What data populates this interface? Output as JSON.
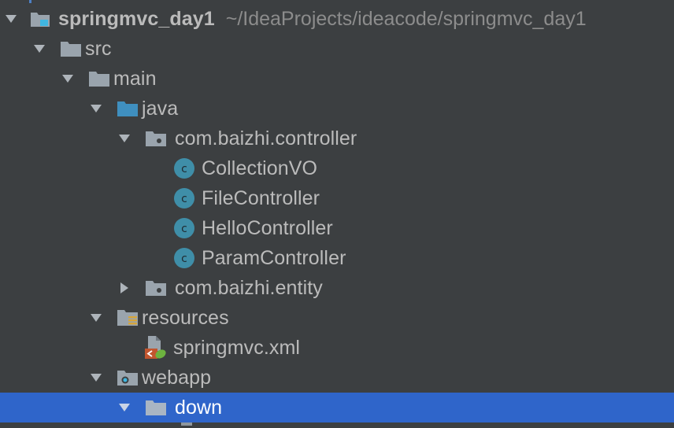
{
  "project_tree": {
    "root": {
      "name": "springmvc_day1",
      "path": "~/IdeaProjects/ideacode/springmvc_day1"
    },
    "items": [
      {
        "label": "src"
      },
      {
        "label": "main"
      },
      {
        "label": "java"
      },
      {
        "label": "com.baizhi.controller"
      },
      {
        "label": "CollectionVO"
      },
      {
        "label": "FileController"
      },
      {
        "label": "HelloController"
      },
      {
        "label": "ParamController"
      },
      {
        "label": "com.baizhi.entity"
      },
      {
        "label": "resources"
      },
      {
        "label": "springmvc.xml"
      },
      {
        "label": "webapp"
      },
      {
        "label": "down"
      }
    ],
    "class_icon_letter": "c"
  },
  "colors": {
    "background": "#3c3f41",
    "selection": "#2f65ca",
    "text": "#bbbbbb",
    "path_text": "#8c8c8c",
    "folder_gray": "#9aa4ad",
    "source_folder_blue": "#3f8fbf",
    "class_icon": "#3f8ea8"
  }
}
